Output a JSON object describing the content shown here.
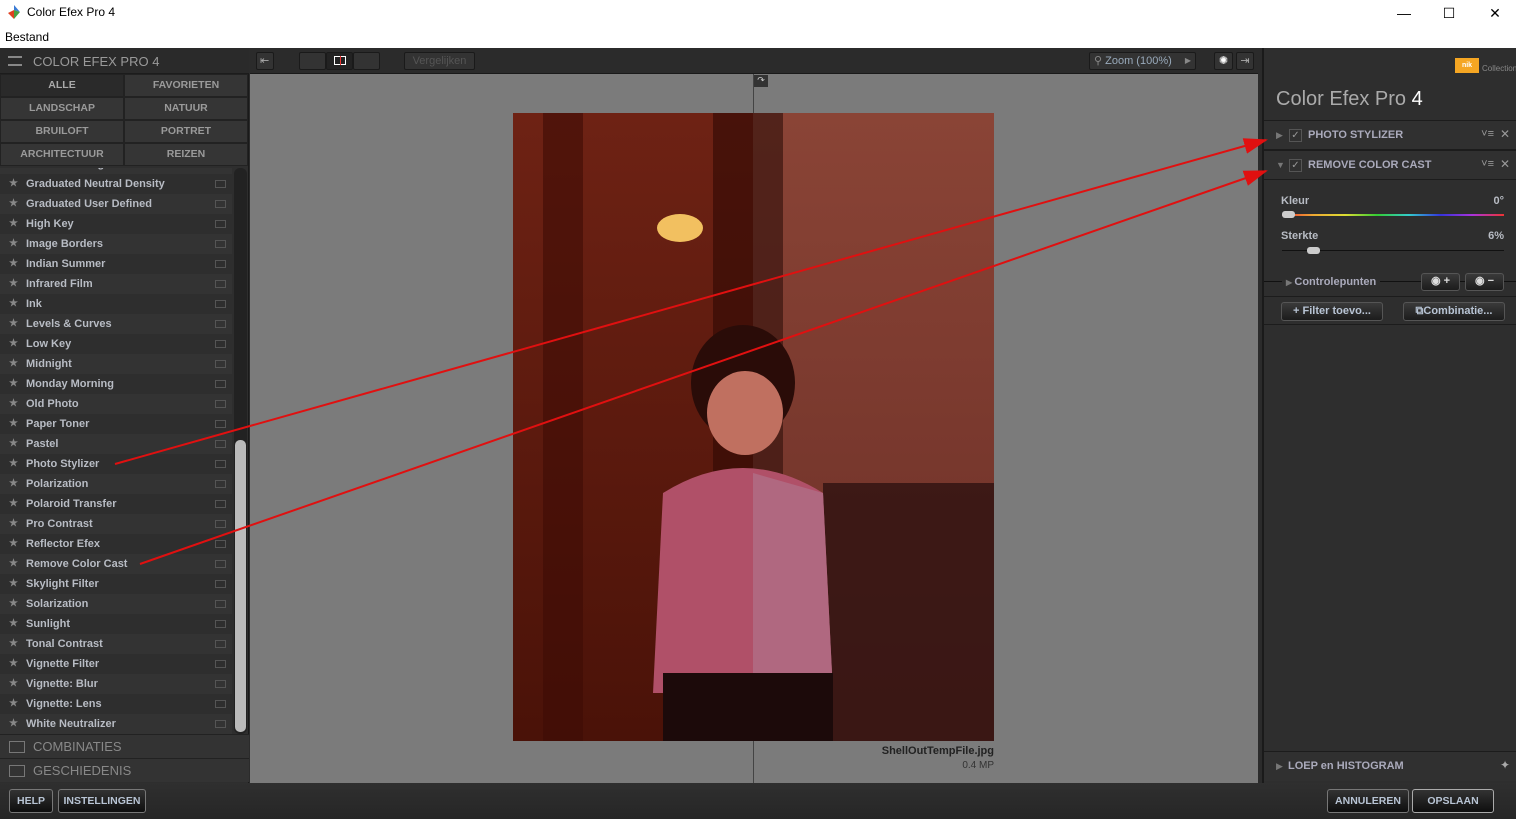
{
  "window": {
    "title": "Color Efex Pro 4",
    "menu": "Bestand",
    "min": "—",
    "max": "☐",
    "close": "✕"
  },
  "left": {
    "title": "COLOR EFEX PRO 4",
    "categories": [
      "ALLE",
      "FAVORIETEN",
      "LANDSCHAP",
      "NATUUR",
      "BRUILOFT",
      "PORTRET",
      "ARCHITECTUUR",
      "REIZEN"
    ],
    "partial_item": "Graduated Fog",
    "filters": [
      "Graduated Neutral Density",
      "Graduated User Defined",
      "High Key",
      "Image Borders",
      "Indian Summer",
      "Infrared Film",
      "Ink",
      "Levels & Curves",
      "Low Key",
      "Midnight",
      "Monday Morning",
      "Old Photo",
      "Paper Toner",
      "Pastel",
      "Photo Stylizer",
      "Polarization",
      "Polaroid Transfer",
      "Pro Contrast",
      "Reflector Efex",
      "Remove Color Cast",
      "Skylight Filter",
      "Solarization",
      "Sunlight",
      "Tonal Contrast",
      "Vignette Filter",
      "Vignette: Blur",
      "Vignette: Lens",
      "White Neutralizer"
    ],
    "combinations": "COMBINATIES",
    "history": "GESCHIEDENIS"
  },
  "toolbar": {
    "compare": "Vergelijken",
    "zoom": "Zoom (100%)"
  },
  "image": {
    "filename": "ShellOutTempFile.jpg",
    "size": "0.4 MP"
  },
  "right": {
    "brand": "nik",
    "collection": "Collection",
    "title": "Color Efex Pro",
    "version": "4",
    "filters": [
      {
        "name": "PHOTO STYLIZER"
      },
      {
        "name": "REMOVE COLOR CAST"
      }
    ],
    "kleur_label": "Kleur",
    "kleur_value": "0°",
    "kleur_fraction": 0,
    "sterkte_label": "Sterkte",
    "sterkte_value": "6%",
    "sterkte_fraction": 0.06,
    "control_points": "Controlepunten",
    "add_filter": "+ Filter toevo...",
    "combination": "Combinatie...",
    "loupe": "LOEP en HISTOGRAM"
  },
  "bottom": {
    "help": "HELP",
    "settings": "INSTELLINGEN",
    "cancel": "ANNULEREN",
    "save": "OPSLAAN"
  },
  "colors": {
    "annotation": "#e01010",
    "accent": "#f5a623"
  }
}
